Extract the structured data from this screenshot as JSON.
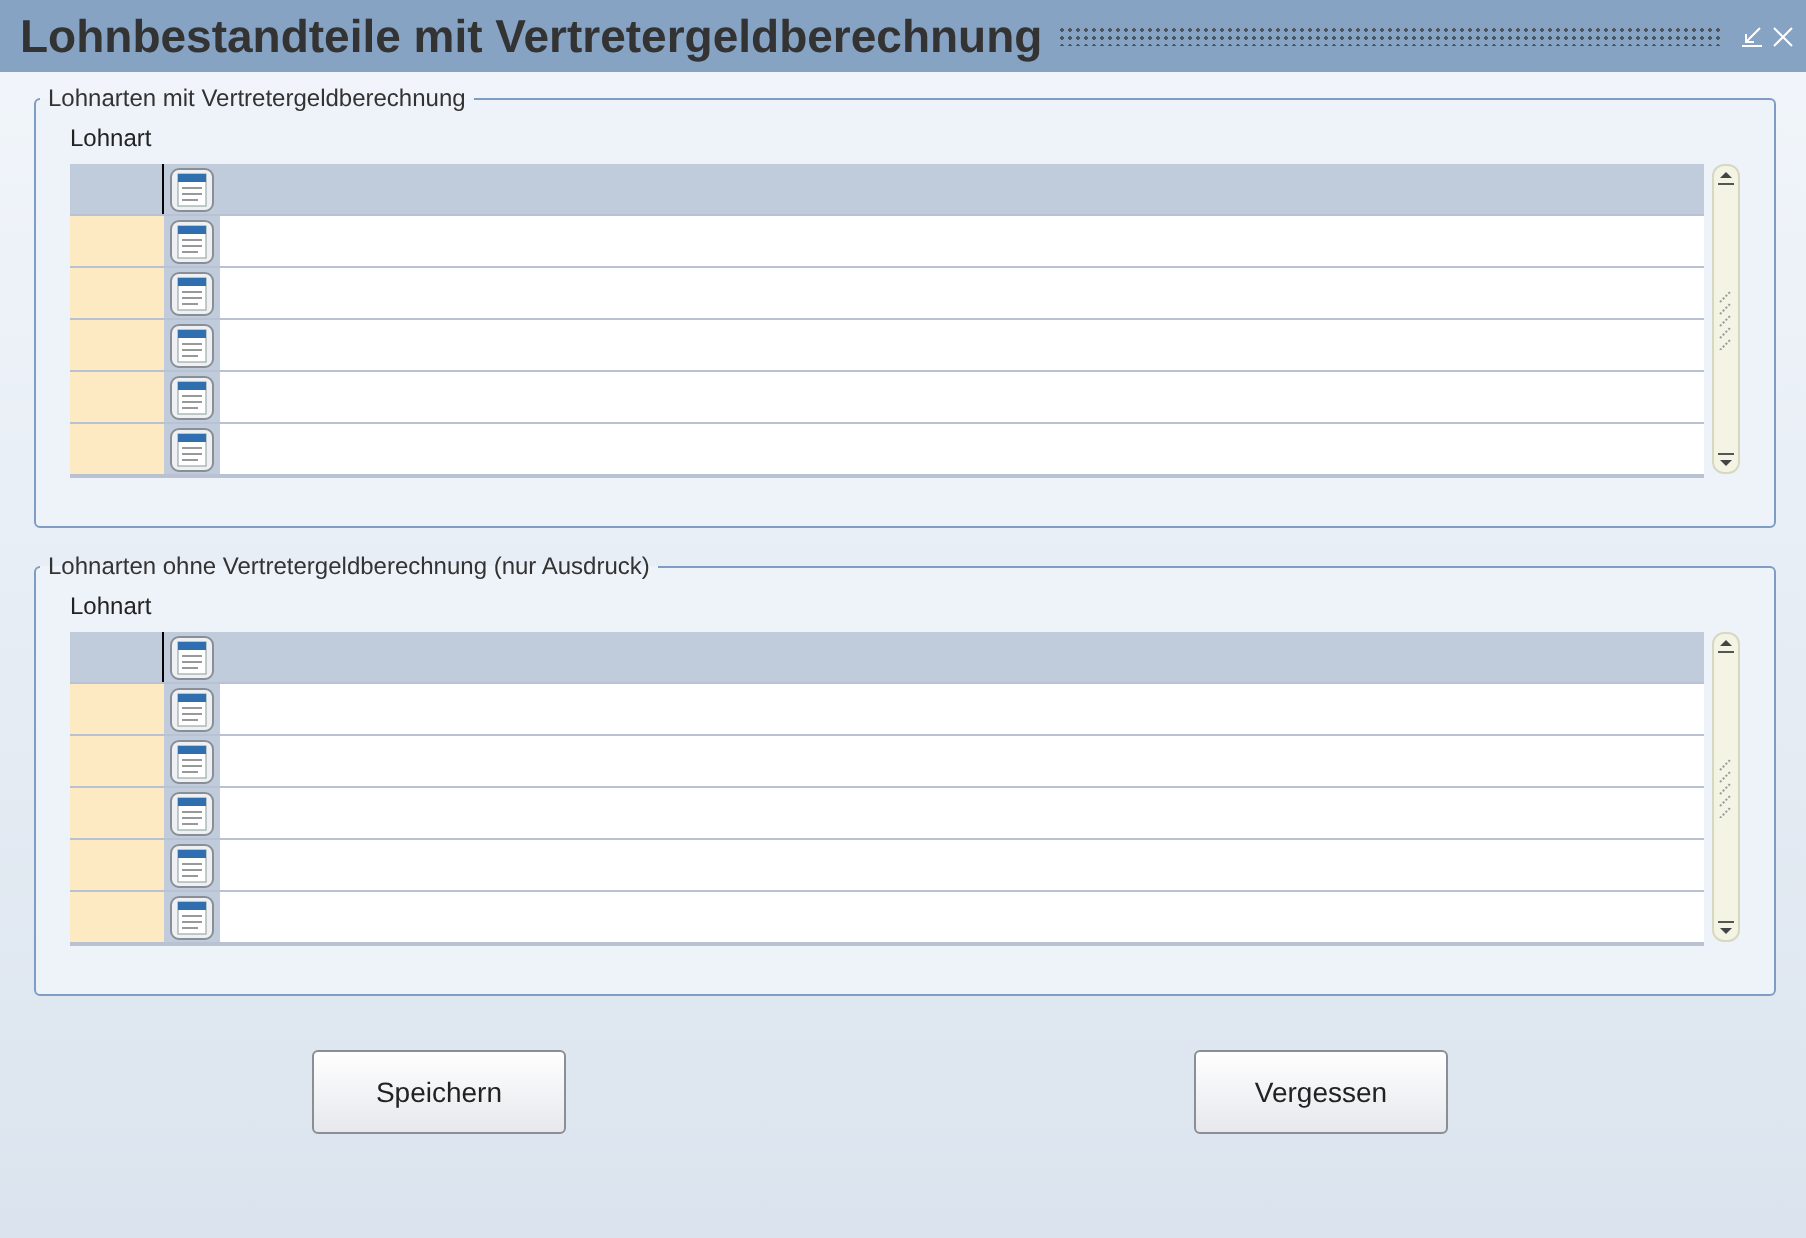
{
  "window": {
    "title": "Lohnbestandteile mit Vertretergeldberechnung"
  },
  "groups": [
    {
      "title": "Lohnarten mit Vertretergeldberechnung",
      "column": "Lohnart",
      "rows": [
        {
          "selected": true
        },
        {
          "selected": false
        },
        {
          "selected": false
        },
        {
          "selected": false
        },
        {
          "selected": false
        },
        {
          "selected": false
        }
      ]
    },
    {
      "title": "Lohnarten ohne Vertretergeldberechnung (nur Ausdruck)",
      "column": "Lohnart",
      "rows": [
        {
          "selected": true
        },
        {
          "selected": false
        },
        {
          "selected": false
        },
        {
          "selected": false
        },
        {
          "selected": false
        },
        {
          "selected": false
        }
      ]
    }
  ],
  "buttons": [
    "Speichern",
    "Vergessen"
  ]
}
